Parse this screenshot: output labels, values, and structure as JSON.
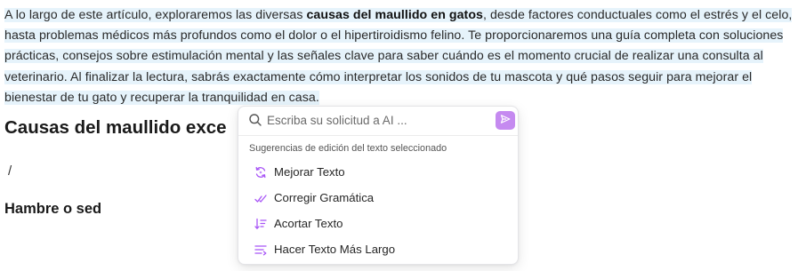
{
  "article": {
    "intro_part1": "A lo largo de este artículo, exploraremos las diversas ",
    "intro_bold": "causas del maullido en gatos",
    "intro_part2": ", desde factores conductuales como el estrés y el celo, hasta problemas médicos más profundos como el dolor o el hipertiroidismo felino. Te proporcionaremos una guía completa con soluciones prácticas, consejos sobre estimulación mental y las señales clave para saber cuándo es el momento crucial de realizar una consulta al veterinario. Al finalizar la lectura, sabrás exactamente cómo interpretar los sonidos de tu mascota y qué pasos seguir para mejorar el bienestar de tu gato y recuperar la tranquilidad en casa.",
    "heading": "Causas del maullido exce",
    "slash_command": "/",
    "subheading": "Hambre o sed"
  },
  "ai_popup": {
    "search_placeholder": "Escriba su solicitud a AI ...",
    "section_label": "Sugerencias de edición del texto seleccionado",
    "items": [
      {
        "label": "Mejorar Texto",
        "icon": "improve-icon"
      },
      {
        "label": "Corregir Gramática",
        "icon": "grammar-check-icon"
      },
      {
        "label": "Acortar Texto",
        "icon": "shorten-icon"
      },
      {
        "label": "Hacer Texto Más Largo",
        "icon": "lengthen-icon"
      }
    ],
    "accent_color": "#c58af0",
    "icon_color": "#a855f7",
    "selection_color": "#e6f3fb"
  }
}
